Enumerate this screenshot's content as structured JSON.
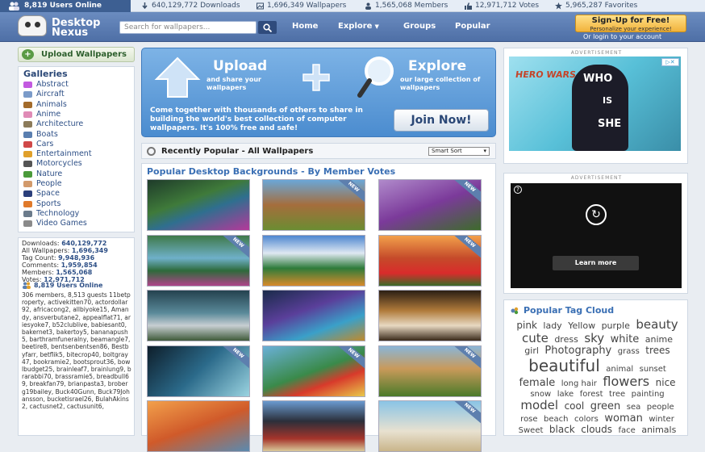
{
  "stats_bar": {
    "online": "8,819 Users Online",
    "downloads": "640,129,772 Downloads",
    "wallpapers": "1,696,349 Wallpapers",
    "members": "1,565,068 Members",
    "votes": "12,971,712 Votes",
    "favorites": "5,965,287 Favorites"
  },
  "header": {
    "logo_line1": "Desktop",
    "logo_line2": "Nexus",
    "search_placeholder": "Search for wallpapers...",
    "nav": [
      "Home",
      "Explore",
      "Groups",
      "Popular"
    ],
    "signup_title": "Sign-Up for Free!",
    "signup_sub": "Personalize your experience!",
    "login": "Or login to your account"
  },
  "sidebar": {
    "upload": "Upload Wallpapers",
    "galleries_title": "Galleries",
    "galleries": [
      {
        "label": "Abstract",
        "color": "#c35ae0"
      },
      {
        "label": "Aircraft",
        "color": "#7b9bc9"
      },
      {
        "label": "Animals",
        "color": "#a36b2b"
      },
      {
        "label": "Anime",
        "color": "#e08bb6"
      },
      {
        "label": "Architecture",
        "color": "#8c7b5a"
      },
      {
        "label": "Boats",
        "color": "#5a7fb0"
      },
      {
        "label": "Cars",
        "color": "#d04848"
      },
      {
        "label": "Entertainment",
        "color": "#e0a02b"
      },
      {
        "label": "Motorcycles",
        "color": "#555555"
      },
      {
        "label": "Nature",
        "color": "#4a9a3a"
      },
      {
        "label": "People",
        "color": "#d29a6b"
      },
      {
        "label": "Space",
        "color": "#2b3f7b"
      },
      {
        "label": "Sports",
        "color": "#e07a2b"
      },
      {
        "label": "Technology",
        "color": "#6b7b8b"
      },
      {
        "label": "Video Games",
        "color": "#8a8a8a"
      }
    ],
    "stats": [
      {
        "label": "Downloads:",
        "value": "640,129,772"
      },
      {
        "label": "All Wallpapers:",
        "value": "1,696,349"
      },
      {
        "label": "Tag Count:",
        "value": "9,948,936"
      },
      {
        "label": "Comments:",
        "value": "1,959,854"
      },
      {
        "label": "Members:",
        "value": "1,565,068"
      },
      {
        "label": "Votes:",
        "value": "12,971,712"
      }
    ],
    "users_online": "8,819 Users Online",
    "users_text": "306 members, 8,513 guests 11betproperty, activekitten70, actordollar92, africacong2, allbiyoke15, Amandy, ansverbutane2, appealflat71, ariesyoke7, b52clublive, babiesant0, bakernet3, bakertoy5, bananapush5, barthramfuneralny, beamangle7, beetire8, bentsenbentsen86, Bestbyfarr, betflik5, bitecrop40, boltgray47, bookramie2, bootsprout36, bowlbudget25, brainleaf7, brainlung9, brarabbi70, brassramie5, breadbull69, breakfan79, brianpasta3, broberg19bailey, Buck40Gunn, Buck79Johansson, bucketisrael26, BulahAkins2, cactusnet2, cactusunit6,"
  },
  "banner": {
    "upload_title": "Upload",
    "upload_sub": "and share your wallpapers",
    "explore_title": "Explore",
    "explore_sub": "our large collection of wallpapers",
    "desc": "Come together with thousands of others to share in building the world's best collection of computer wallpapers. It's 100% free and safe!",
    "join": "Join Now!"
  },
  "recent": {
    "title": "Recently Popular - All Wallpapers",
    "sort": "Smart Sort"
  },
  "grid": {
    "title": "Popular Desktop Backgrounds - By Member Votes",
    "new_label": "NEW",
    "thumbs": [
      {
        "new": false,
        "bg": "linear-gradient(160deg,#1e3b2a,#3f7a3a 40%,#2f6f8f 60%,#b5389a)"
      },
      {
        "new": true,
        "bg": "linear-gradient(180deg,#6aa7d8,#a56d3c 50%,#6b8c32)"
      },
      {
        "new": true,
        "bg": "linear-gradient(160deg,#b08acb,#7b3a9a 50%,#3d6b2b)"
      },
      {
        "new": true,
        "bg": "linear-gradient(180deg,#3f7a4a,#6fb0c9 45%,#2d6a3a 70%,#b0448a)"
      },
      {
        "new": false,
        "bg": "linear-gradient(180deg,#4e86d0,#dfe8f2 35%,#2e7b3a 65%,#d88a2b)"
      },
      {
        "new": true,
        "bg": "linear-gradient(180deg,#f2a04b,#c54a2a 45%,#d92b2b 75%,#3a6b2a)"
      },
      {
        "new": false,
        "bg": "linear-gradient(180deg,#24424f,#5b8a9a 45%,#c7ced2 70%,#3f5a3a)"
      },
      {
        "new": false,
        "bg": "linear-gradient(160deg,#1a2b4a,#5a3f9a 40%,#3aa0c9 70%,#c08a2b)"
      },
      {
        "new": false,
        "bg": "linear-gradient(180deg,#2b1f14,#b07a3a 40%,#e8d9c2 70%,#3a2a1a)"
      },
      {
        "new": true,
        "bg": "linear-gradient(135deg,#0e1e2b,#2b6a8a 50%,#9ad3e0)"
      },
      {
        "new": true,
        "bg": "linear-gradient(160deg,#6ab0d8,#3a8a4a 50%,#d83a2b 70%,#e8c94a)"
      },
      {
        "new": true,
        "bg": "linear-gradient(180deg,#8ab6d8,#c99a5a 45%,#4a7a2a)"
      },
      {
        "new": false,
        "bg": "linear-gradient(160deg,#f2a04b,#d05a2a 50%,#5a8ab0)"
      },
      {
        "new": false,
        "bg": "linear-gradient(180deg,#6a9ad0,#2b2f3a 40%,#a5342b 75%,#d9c99a)"
      },
      {
        "new": true,
        "bg": "linear-gradient(180deg,#8ac4e6,#e8e1d0 60%,#c9b58a)"
      }
    ]
  },
  "ads": {
    "label": "ADVERTISEMENT",
    "ad1_headline1": "WHO",
    "ad1_headline2": "IS",
    "ad1_headline3": "SHE",
    "ad1_brand": "HERO WARS",
    "ad2_button": "Learn more"
  },
  "tag_cloud": {
    "title": "Popular Tag Cloud",
    "tags": [
      {
        "t": "pink",
        "s": 12
      },
      {
        "t": "lady",
        "s": 11
      },
      {
        "t": "Yellow",
        "s": 11
      },
      {
        "t": "purple",
        "s": 11
      },
      {
        "t": "beauty",
        "s": 15
      },
      {
        "t": "cute",
        "s": 15
      },
      {
        "t": "dress",
        "s": 11
      },
      {
        "t": "sky",
        "s": 15
      },
      {
        "t": "white",
        "s": 13
      },
      {
        "t": "anime",
        "s": 11
      },
      {
        "t": "girl",
        "s": 11
      },
      {
        "t": "Photography",
        "s": 13
      },
      {
        "t": "grass",
        "s": 10
      },
      {
        "t": "trees",
        "s": 12
      },
      {
        "t": "beautiful",
        "s": 20
      },
      {
        "t": "animal",
        "s": 10
      },
      {
        "t": "sunset",
        "s": 10
      },
      {
        "t": "female",
        "s": 13
      },
      {
        "t": "long hair",
        "s": 10
      },
      {
        "t": "flowers",
        "s": 16
      },
      {
        "t": "nice",
        "s": 12
      },
      {
        "t": "snow",
        "s": 10
      },
      {
        "t": "lake",
        "s": 10
      },
      {
        "t": "forest",
        "s": 10
      },
      {
        "t": "tree",
        "s": 10
      },
      {
        "t": "painting",
        "s": 10
      },
      {
        "t": "model",
        "s": 15
      },
      {
        "t": "cool",
        "s": 12
      },
      {
        "t": "green",
        "s": 13
      },
      {
        "t": "sea",
        "s": 10
      },
      {
        "t": "people",
        "s": 10
      },
      {
        "t": "rose",
        "s": 10
      },
      {
        "t": "beach",
        "s": 10
      },
      {
        "t": "colors",
        "s": 10
      },
      {
        "t": "woman",
        "s": 13
      },
      {
        "t": "winter",
        "s": 10
      },
      {
        "t": "Sweet",
        "s": 10
      },
      {
        "t": "black",
        "s": 12
      },
      {
        "t": "clouds",
        "s": 12
      },
      {
        "t": "face",
        "s": 10
      },
      {
        "t": "animals",
        "s": 11
      }
    ]
  }
}
